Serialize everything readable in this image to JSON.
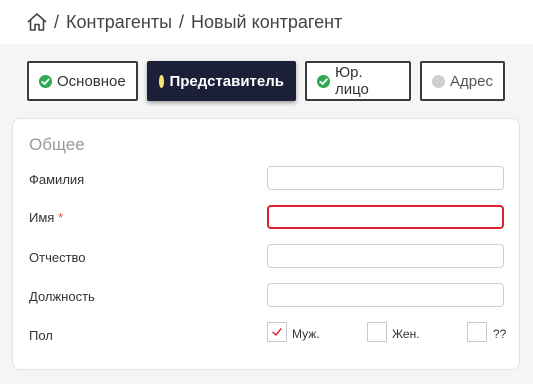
{
  "breadcrumb": {
    "items": [
      "Контрагенты",
      "Новый контрагент"
    ],
    "separator": "/"
  },
  "tabs": [
    {
      "label": "Основное",
      "status": "ok",
      "icon": "check-circle-icon",
      "color": "#2fa84f"
    },
    {
      "label": "Представитель",
      "status": "active",
      "icon": "yellow-dot-icon",
      "color": "#f4e27a"
    },
    {
      "label": "Юр. лицо",
      "status": "ok",
      "icon": "check-circle-icon",
      "color": "#2fa84f"
    },
    {
      "label": "Адрес",
      "status": "pending",
      "icon": "gray-dot-icon",
      "color": "#cfcfcf"
    }
  ],
  "form": {
    "section_title": "Общее",
    "fields": {
      "surname": {
        "label": "Фамилия",
        "value": ""
      },
      "name": {
        "label": "Имя",
        "required_mark": "*",
        "value": "",
        "error": true
      },
      "patronymic": {
        "label": "Отчество",
        "value": ""
      },
      "position": {
        "label": "Должность",
        "value": ""
      }
    },
    "gender": {
      "label": "Пол",
      "options": [
        {
          "label": "Муж.",
          "checked": true
        },
        {
          "label": "Жен.",
          "checked": false
        },
        {
          "label": "??",
          "checked": false
        }
      ]
    }
  },
  "colors": {
    "active_tab_bg": "#1b1f38",
    "error_border": "#d9232e",
    "required_mark": "#d9534f"
  }
}
